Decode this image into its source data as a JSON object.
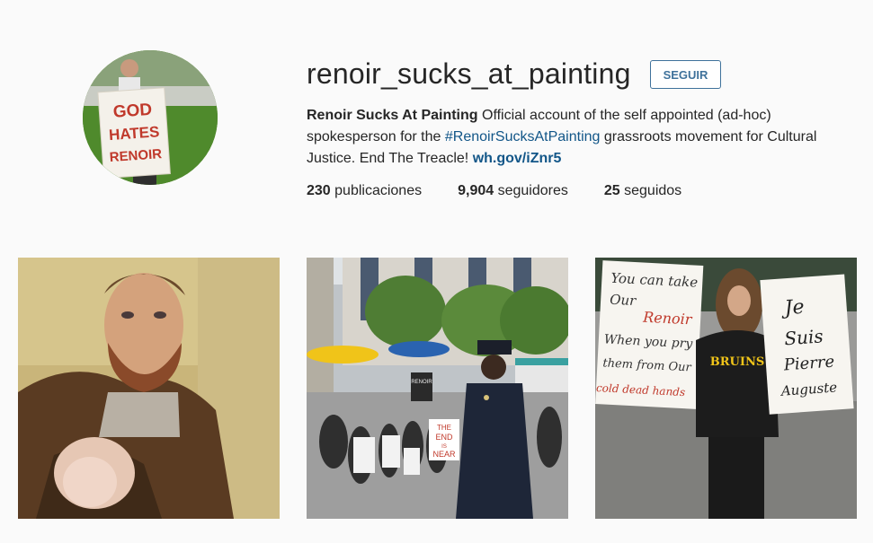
{
  "profile": {
    "username": "renoir_sucks_at_painting",
    "follow_label": "SEGUIR",
    "avatar_sign": [
      "GOD",
      "HATES",
      "RENOIR"
    ]
  },
  "bio": {
    "name": "Renoir Sucks At Painting",
    "text_1": " Official account of the self appointed (ad-hoc) spokesperson for the ",
    "hashtag": "#RenoirSucksAtPainting",
    "text_2": " grassroots movement for Cultural Justice. End The Treacle! ",
    "link": "wh.gov/iZnr5"
  },
  "stats": {
    "posts_num": "230",
    "posts_label": " publicaciones",
    "followers_num": "9,904",
    "followers_label": " seguidores",
    "following_num": "25",
    "following_label": " seguidos"
  },
  "posts": {
    "post2_signs": [
      "RENOIR",
      "THE",
      "END",
      "IS",
      "NEAR"
    ],
    "post3_left_sign": [
      "You can take",
      "Our",
      "Renoir",
      "When you pry",
      "them from Our",
      "cold dead hands"
    ],
    "post3_right_sign": [
      "Je",
      "Suis",
      "Pierre",
      "Auguste"
    ],
    "post3_jacket": "BRUINS"
  },
  "colors": {
    "link": "#125688",
    "button": "#3f729b",
    "background": "#fafafa"
  }
}
